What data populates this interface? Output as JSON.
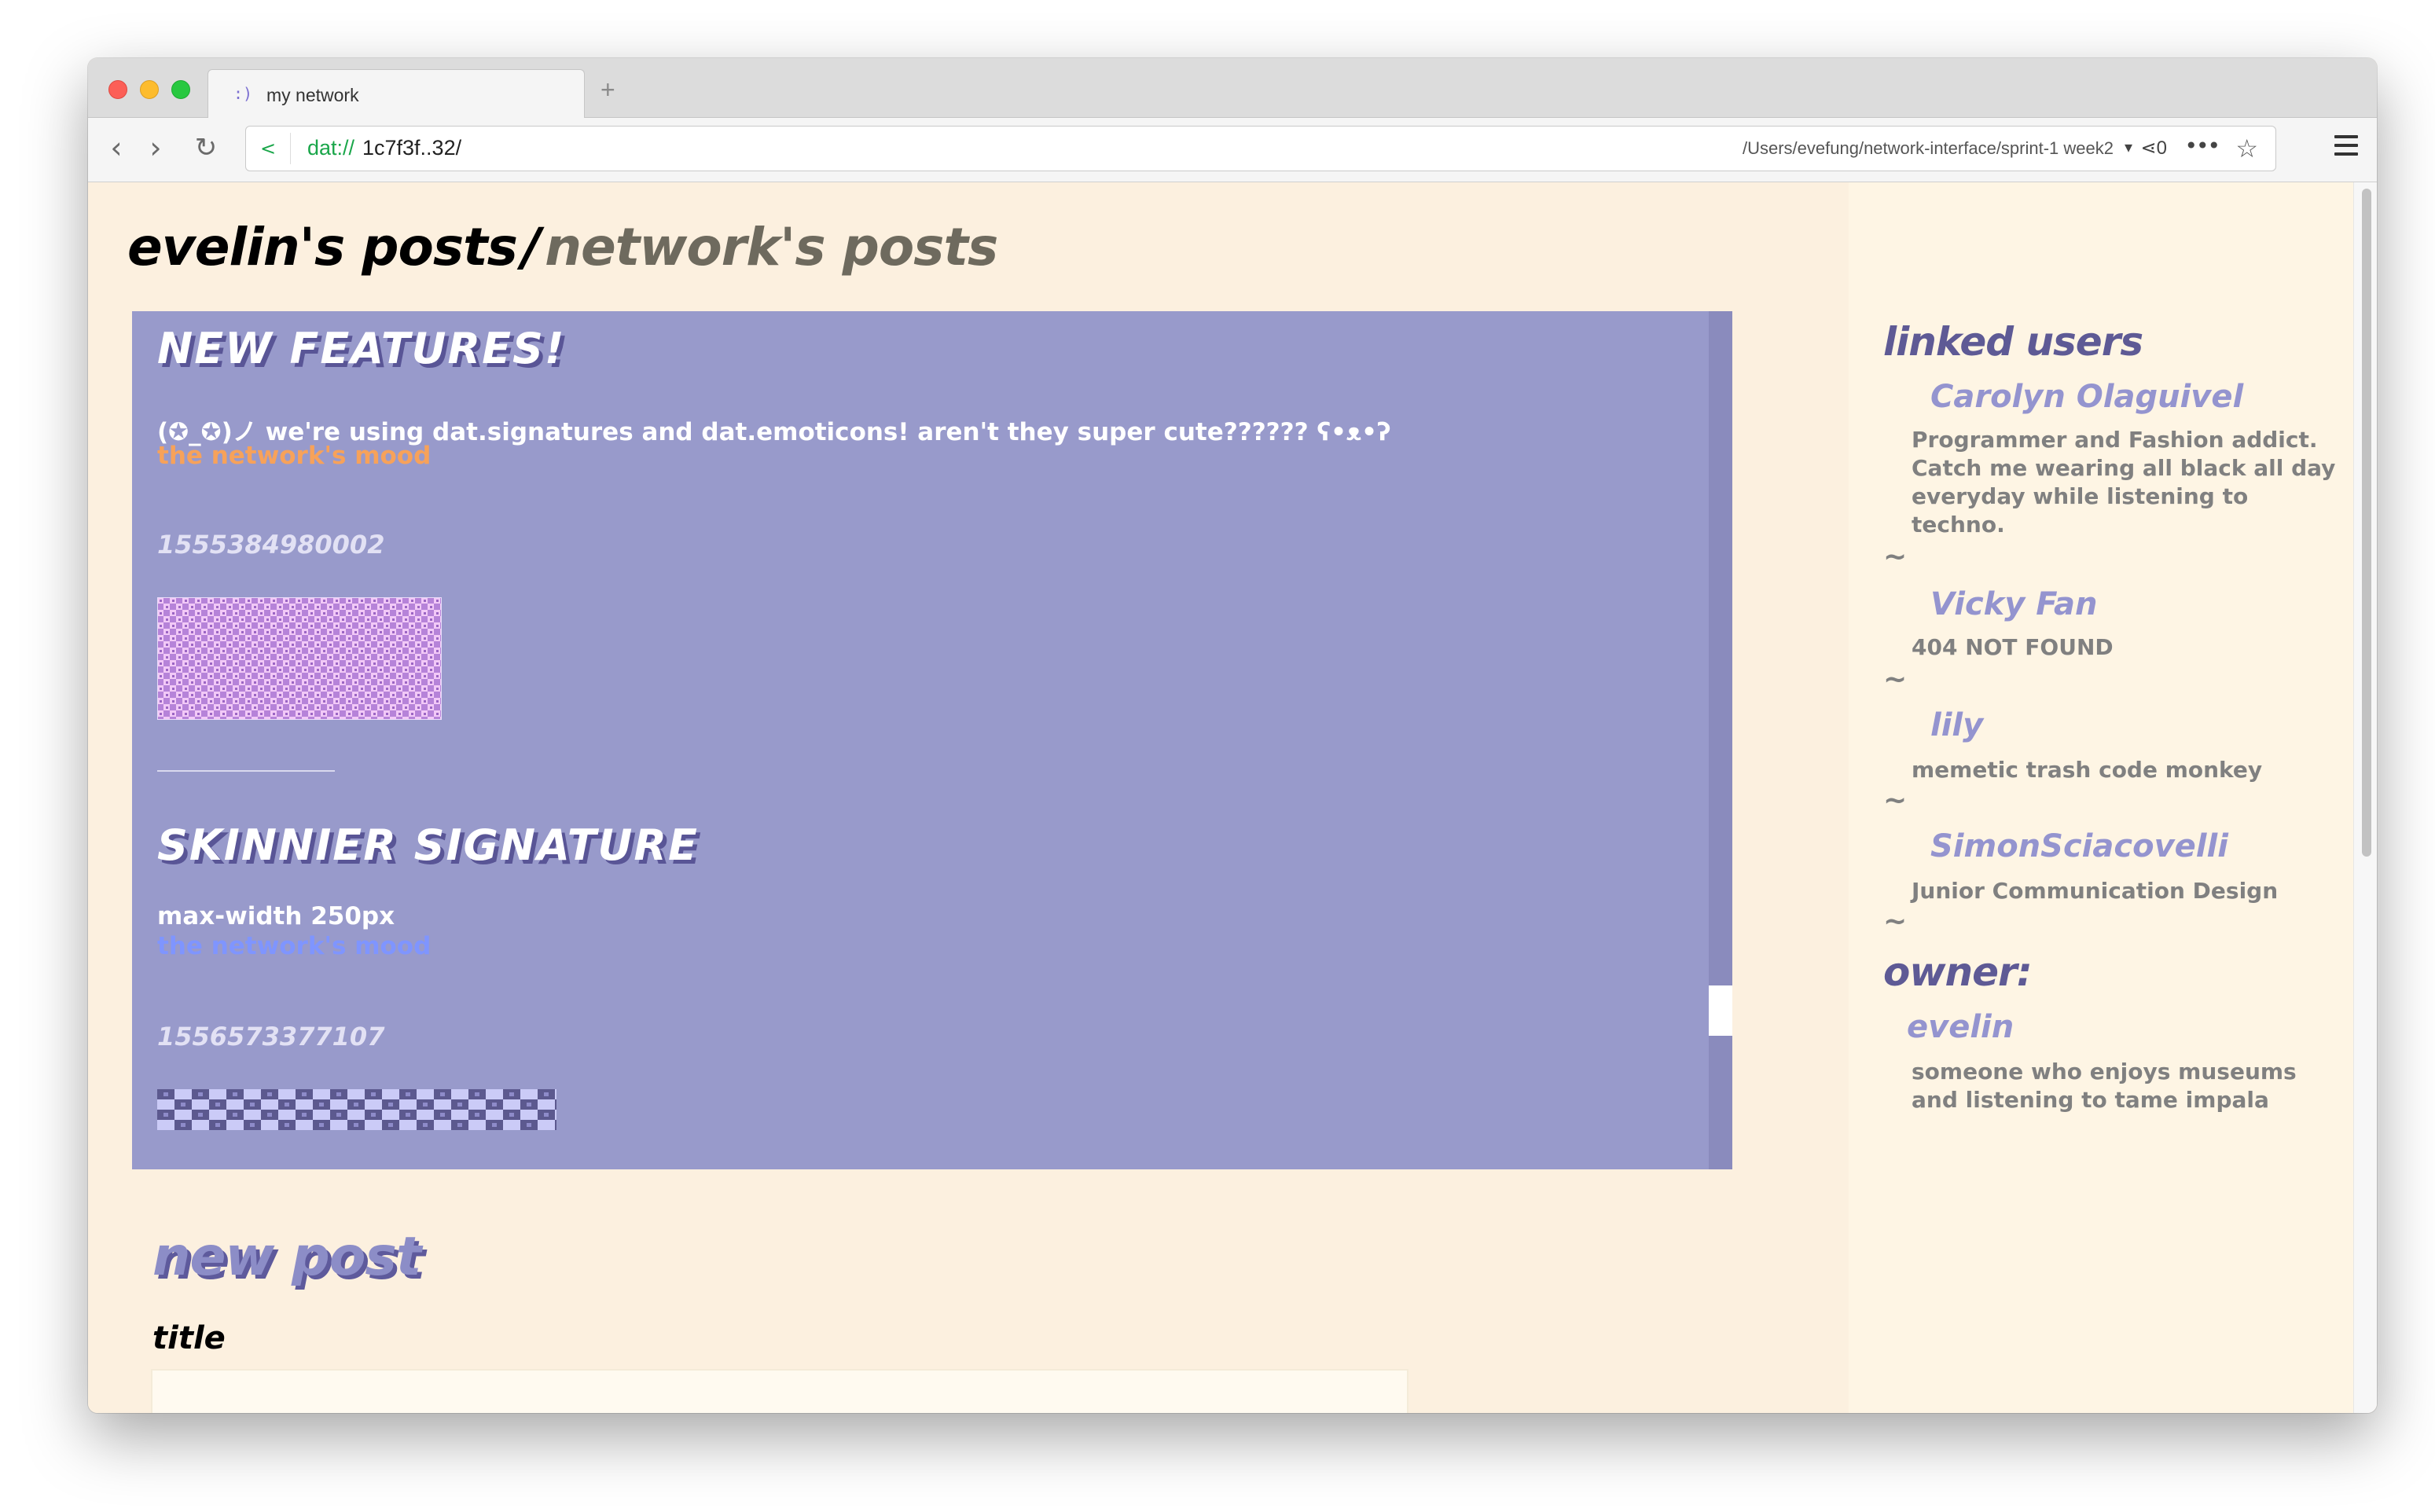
{
  "browser": {
    "tab_favicon": ":)",
    "tab_title": "my network",
    "new_tab": "+",
    "url_protocol": "dat://",
    "url_host": "1c7f3f..32/",
    "local_path": "/Users/evefung/network-interface/sprint-1 week2",
    "peer_count": "0"
  },
  "header": {
    "mine": "evelin's posts",
    "slash": "/",
    "network": "network's posts"
  },
  "posts": [
    {
      "title": "NEW FEATURES!",
      "body": "(✪_✪)ノ we're using dat.signatures and dat.emoticons! aren't they super cute?????? ʕ•ᴥ•ʔ",
      "mood": "the network's mood",
      "mood_color": "#f7a25a",
      "timestamp": "1555384980002"
    },
    {
      "title": "SKINNIER SIGNATURE",
      "body": "max-width 250px",
      "mood": "the network's mood",
      "mood_color": "#7f95ff",
      "timestamp": "1556573377107"
    }
  ],
  "new_post": {
    "heading": "new post",
    "title_label": "title"
  },
  "sidebar": {
    "linked_heading": "linked users",
    "users": [
      {
        "name": "Carolyn Olaguivel",
        "bio": "Programmer and Fashion addict. Catch me wearing all black all day everyday while listening to techno."
      },
      {
        "name": "Vicky Fan",
        "bio": "404 NOT FOUND"
      },
      {
        "name": "lily",
        "bio": "memetic trash code monkey"
      },
      {
        "name": "SimonSciacovelli",
        "bio": "Junior Communication Design"
      }
    ],
    "separator": "~",
    "owner_heading": "owner:",
    "owner": {
      "name": "evelin",
      "bio": "someone who enjoys museums and listening to tame impala"
    }
  },
  "colors": {
    "page_bg": "#fcf0df",
    "sidebar_bg": "#fef5e4",
    "posts_panel": "#989acb",
    "accent_dark": "#5e5a95",
    "accent_light": "#9494cf"
  }
}
